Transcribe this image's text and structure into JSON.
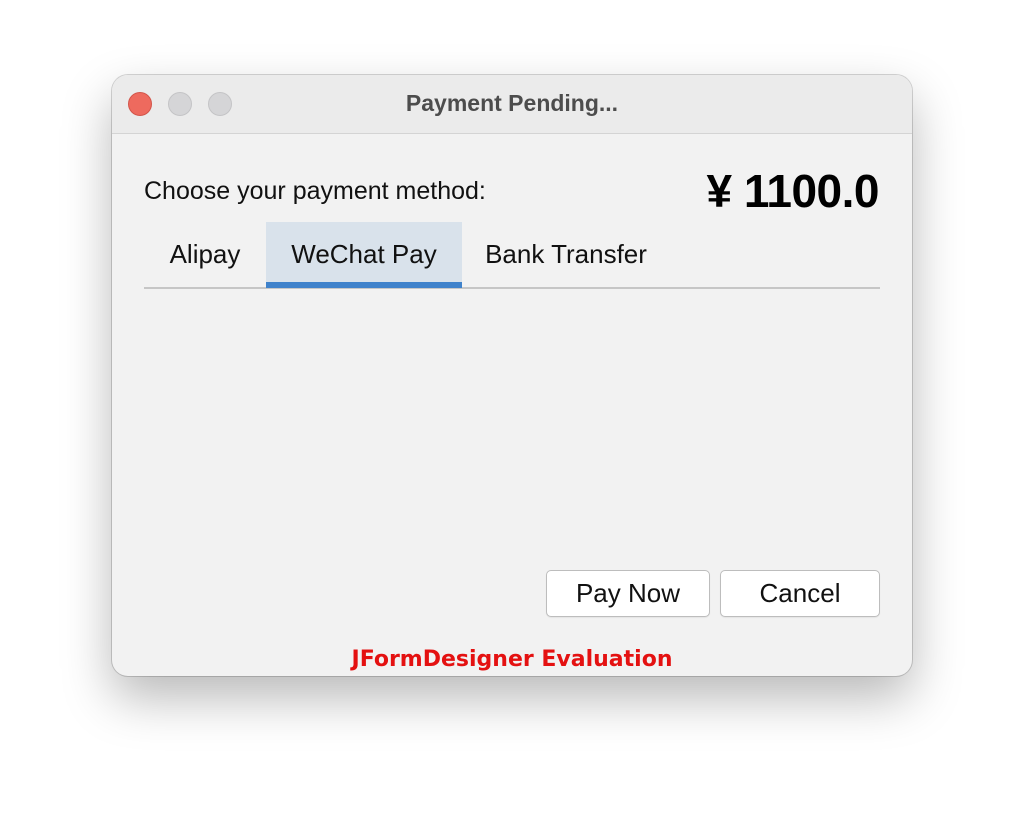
{
  "window": {
    "title": "Payment Pending..."
  },
  "traffic_lights": [
    {
      "name": "close",
      "color": "#ee6a5e"
    },
    {
      "name": "minimize",
      "color": "#d5d5d7"
    },
    {
      "name": "maximize",
      "color": "#d5d5d7"
    }
  ],
  "header": {
    "prompt": "Choose your payment method:",
    "amount": "¥ 1100.0"
  },
  "tabs": [
    {
      "label": "Alipay",
      "selected": false
    },
    {
      "label": "WeChat Pay",
      "selected": true
    },
    {
      "label": "Bank Transfer",
      "selected": false
    }
  ],
  "actions": {
    "pay_label": "Pay Now",
    "cancel_label": "Cancel"
  },
  "footer": {
    "evaluation_text": "JFormDesigner Evaluation"
  },
  "colors": {
    "accent": "#3f82cb",
    "selected_tab_bg": "#d9e2eb",
    "evaluation_text": "#e41111"
  }
}
